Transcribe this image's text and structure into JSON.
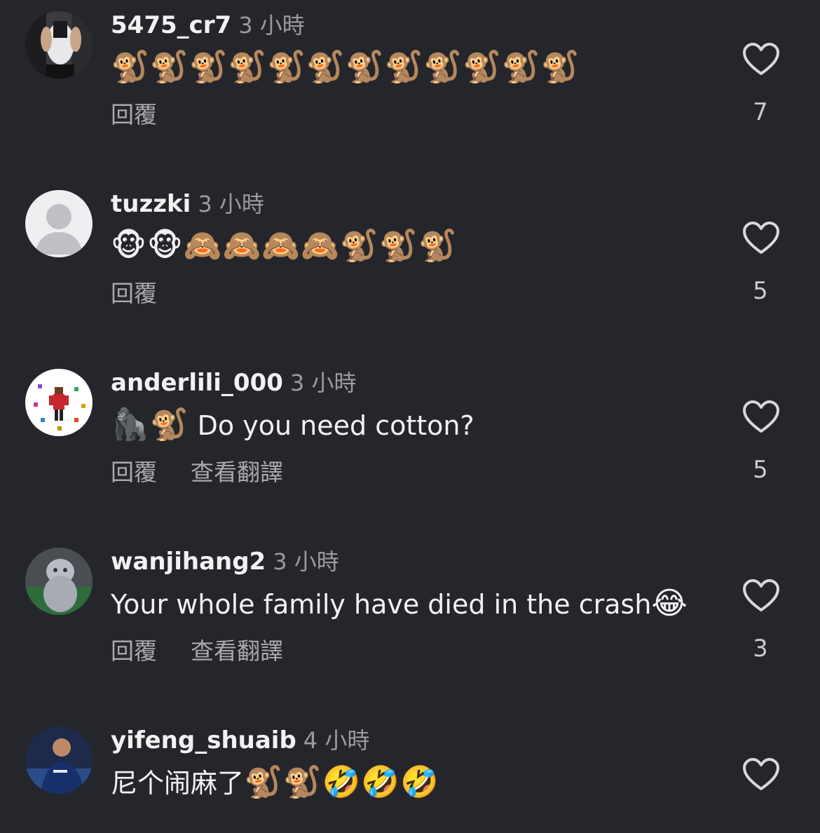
{
  "comments": [
    {
      "username": "5475_cr7",
      "time": "3 小時",
      "text": "",
      "emoji": "🐒🐒🐒🐒🐒🐒🐒🐒🐒🐒🐒🐒",
      "reply_label": "回覆",
      "translate_label": "",
      "likes": "7",
      "avatar_icon": "gym-photo-avatar"
    },
    {
      "username": "tuzzki",
      "time": "3 小時",
      "text": "",
      "emoji": "🐵🐵🙈🙈🙈🙈🐒🐒🐒",
      "reply_label": "回覆",
      "translate_label": "",
      "likes": "5",
      "avatar_icon": "default-person-avatar"
    },
    {
      "username": "anderlili_000",
      "time": "3 小時",
      "emoji": "🦍🐒",
      "text": " Do you need cotton?",
      "reply_label": "回覆",
      "translate_label": "查看翻譯",
      "likes": "5",
      "avatar_icon": "pixel-character-avatar"
    },
    {
      "username": "wanjihang2",
      "time": "3 小時",
      "text": "Your whole family have died in the crash",
      "emoji": "😂",
      "reply_label": "回覆",
      "translate_label": "查看翻譯",
      "likes": "3",
      "avatar_icon": "figurine-avatar"
    },
    {
      "username": "yifeng_shuaib",
      "time": "4 小時",
      "text": "尼个闹麻了",
      "emoji": "🐒🐒🤣🤣🤣",
      "reply_label": "",
      "translate_label": "",
      "likes": "",
      "avatar_icon": "footballer-avatar"
    }
  ],
  "colors": {
    "background": "#25262b",
    "username": "#f2f2f2",
    "meta": "#9a9ba0",
    "heart_stroke": "#d8d8da"
  }
}
